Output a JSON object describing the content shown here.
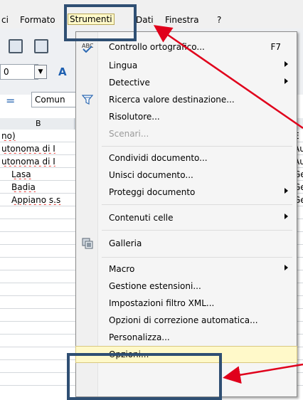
{
  "menubar": {
    "items": [
      "ci",
      "Formato",
      "Strumenti",
      "Dati",
      "Finestra",
      "?"
    ],
    "active": "Strumenti"
  },
  "toolbar": {
    "font_size_value": "0",
    "cell_ref_value": "Comun"
  },
  "sheet": {
    "column_b": "B",
    "rows": [
      {
        "b": "no)",
        "right": "E"
      },
      {
        "b": "utonoma di I",
        "right": "Au"
      },
      {
        "b": "utonoma di I",
        "right": "Au"
      },
      {
        "b": "Lasa",
        "right": "Ge"
      },
      {
        "b": "Badia",
        "right": "Ge"
      },
      {
        "b": "Appiano s.s",
        "right": "Ge"
      }
    ]
  },
  "menu": {
    "items": [
      {
        "label": "Controllo ortografico...",
        "shortcut": "F7",
        "icon": "spellcheck-icon"
      },
      {
        "label": "Lingua",
        "submenu": true
      },
      {
        "label": "Detective",
        "submenu": true
      },
      {
        "label": "Ricerca valore destinazione...",
        "icon": "goal-seek-icon"
      },
      {
        "label": "Risolutore..."
      },
      {
        "label": "Scenari...",
        "disabled": true
      },
      {
        "label": "Condividi documento..."
      },
      {
        "label": "Unisci documento..."
      },
      {
        "label": "Proteggi documento",
        "submenu": true
      },
      {
        "label": "Contenuti celle",
        "submenu": true
      },
      {
        "label": "Galleria",
        "icon": "gallery-icon"
      },
      {
        "label": "Macro",
        "submenu": true
      },
      {
        "label": "Gestione estensioni..."
      },
      {
        "label": "Impostazioni filtro XML..."
      },
      {
        "label": "Opzioni di correzione automatica..."
      },
      {
        "label": "Personalizza..."
      },
      {
        "label": "Opzioni..."
      }
    ]
  },
  "colors": {
    "highlight_box": "#2f4f73",
    "arrow": "#e0001b",
    "menu_hover": "#fff9c9"
  }
}
